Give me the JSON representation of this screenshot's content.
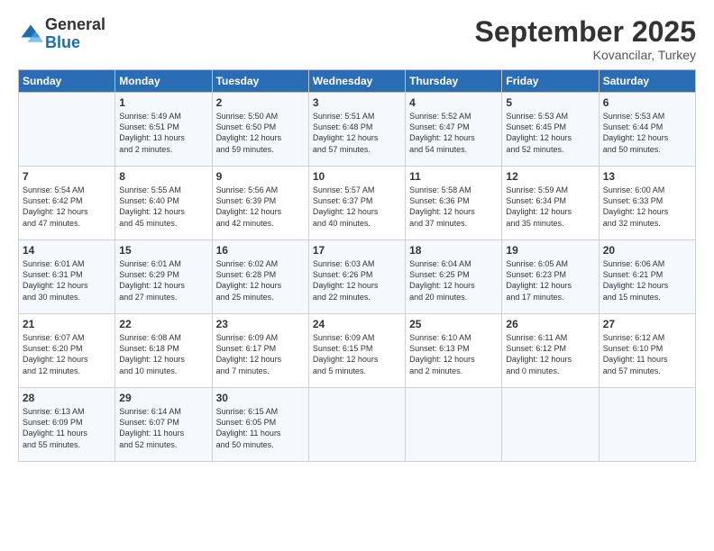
{
  "logo": {
    "general": "General",
    "blue": "Blue"
  },
  "title": "September 2025",
  "subtitle": "Kovancilar, Turkey",
  "header_days": [
    "Sunday",
    "Monday",
    "Tuesday",
    "Wednesday",
    "Thursday",
    "Friday",
    "Saturday"
  ],
  "weeks": [
    [
      {
        "day": "",
        "info": ""
      },
      {
        "day": "1",
        "info": "Sunrise: 5:49 AM\nSunset: 6:51 PM\nDaylight: 13 hours\nand 2 minutes."
      },
      {
        "day": "2",
        "info": "Sunrise: 5:50 AM\nSunset: 6:50 PM\nDaylight: 12 hours\nand 59 minutes."
      },
      {
        "day": "3",
        "info": "Sunrise: 5:51 AM\nSunset: 6:48 PM\nDaylight: 12 hours\nand 57 minutes."
      },
      {
        "day": "4",
        "info": "Sunrise: 5:52 AM\nSunset: 6:47 PM\nDaylight: 12 hours\nand 54 minutes."
      },
      {
        "day": "5",
        "info": "Sunrise: 5:53 AM\nSunset: 6:45 PM\nDaylight: 12 hours\nand 52 minutes."
      },
      {
        "day": "6",
        "info": "Sunrise: 5:53 AM\nSunset: 6:44 PM\nDaylight: 12 hours\nand 50 minutes."
      }
    ],
    [
      {
        "day": "7",
        "info": "Sunrise: 5:54 AM\nSunset: 6:42 PM\nDaylight: 12 hours\nand 47 minutes."
      },
      {
        "day": "8",
        "info": "Sunrise: 5:55 AM\nSunset: 6:40 PM\nDaylight: 12 hours\nand 45 minutes."
      },
      {
        "day": "9",
        "info": "Sunrise: 5:56 AM\nSunset: 6:39 PM\nDaylight: 12 hours\nand 42 minutes."
      },
      {
        "day": "10",
        "info": "Sunrise: 5:57 AM\nSunset: 6:37 PM\nDaylight: 12 hours\nand 40 minutes."
      },
      {
        "day": "11",
        "info": "Sunrise: 5:58 AM\nSunset: 6:36 PM\nDaylight: 12 hours\nand 37 minutes."
      },
      {
        "day": "12",
        "info": "Sunrise: 5:59 AM\nSunset: 6:34 PM\nDaylight: 12 hours\nand 35 minutes."
      },
      {
        "day": "13",
        "info": "Sunrise: 6:00 AM\nSunset: 6:33 PM\nDaylight: 12 hours\nand 32 minutes."
      }
    ],
    [
      {
        "day": "14",
        "info": "Sunrise: 6:01 AM\nSunset: 6:31 PM\nDaylight: 12 hours\nand 30 minutes."
      },
      {
        "day": "15",
        "info": "Sunrise: 6:01 AM\nSunset: 6:29 PM\nDaylight: 12 hours\nand 27 minutes."
      },
      {
        "day": "16",
        "info": "Sunrise: 6:02 AM\nSunset: 6:28 PM\nDaylight: 12 hours\nand 25 minutes."
      },
      {
        "day": "17",
        "info": "Sunrise: 6:03 AM\nSunset: 6:26 PM\nDaylight: 12 hours\nand 22 minutes."
      },
      {
        "day": "18",
        "info": "Sunrise: 6:04 AM\nSunset: 6:25 PM\nDaylight: 12 hours\nand 20 minutes."
      },
      {
        "day": "19",
        "info": "Sunrise: 6:05 AM\nSunset: 6:23 PM\nDaylight: 12 hours\nand 17 minutes."
      },
      {
        "day": "20",
        "info": "Sunrise: 6:06 AM\nSunset: 6:21 PM\nDaylight: 12 hours\nand 15 minutes."
      }
    ],
    [
      {
        "day": "21",
        "info": "Sunrise: 6:07 AM\nSunset: 6:20 PM\nDaylight: 12 hours\nand 12 minutes."
      },
      {
        "day": "22",
        "info": "Sunrise: 6:08 AM\nSunset: 6:18 PM\nDaylight: 12 hours\nand 10 minutes."
      },
      {
        "day": "23",
        "info": "Sunrise: 6:09 AM\nSunset: 6:17 PM\nDaylight: 12 hours\nand 7 minutes."
      },
      {
        "day": "24",
        "info": "Sunrise: 6:09 AM\nSunset: 6:15 PM\nDaylight: 12 hours\nand 5 minutes."
      },
      {
        "day": "25",
        "info": "Sunrise: 6:10 AM\nSunset: 6:13 PM\nDaylight: 12 hours\nand 2 minutes."
      },
      {
        "day": "26",
        "info": "Sunrise: 6:11 AM\nSunset: 6:12 PM\nDaylight: 12 hours\nand 0 minutes."
      },
      {
        "day": "27",
        "info": "Sunrise: 6:12 AM\nSunset: 6:10 PM\nDaylight: 11 hours\nand 57 minutes."
      }
    ],
    [
      {
        "day": "28",
        "info": "Sunrise: 6:13 AM\nSunset: 6:09 PM\nDaylight: 11 hours\nand 55 minutes."
      },
      {
        "day": "29",
        "info": "Sunrise: 6:14 AM\nSunset: 6:07 PM\nDaylight: 11 hours\nand 52 minutes."
      },
      {
        "day": "30",
        "info": "Sunrise: 6:15 AM\nSunset: 6:05 PM\nDaylight: 11 hours\nand 50 minutes."
      },
      {
        "day": "",
        "info": ""
      },
      {
        "day": "",
        "info": ""
      },
      {
        "day": "",
        "info": ""
      },
      {
        "day": "",
        "info": ""
      }
    ]
  ]
}
